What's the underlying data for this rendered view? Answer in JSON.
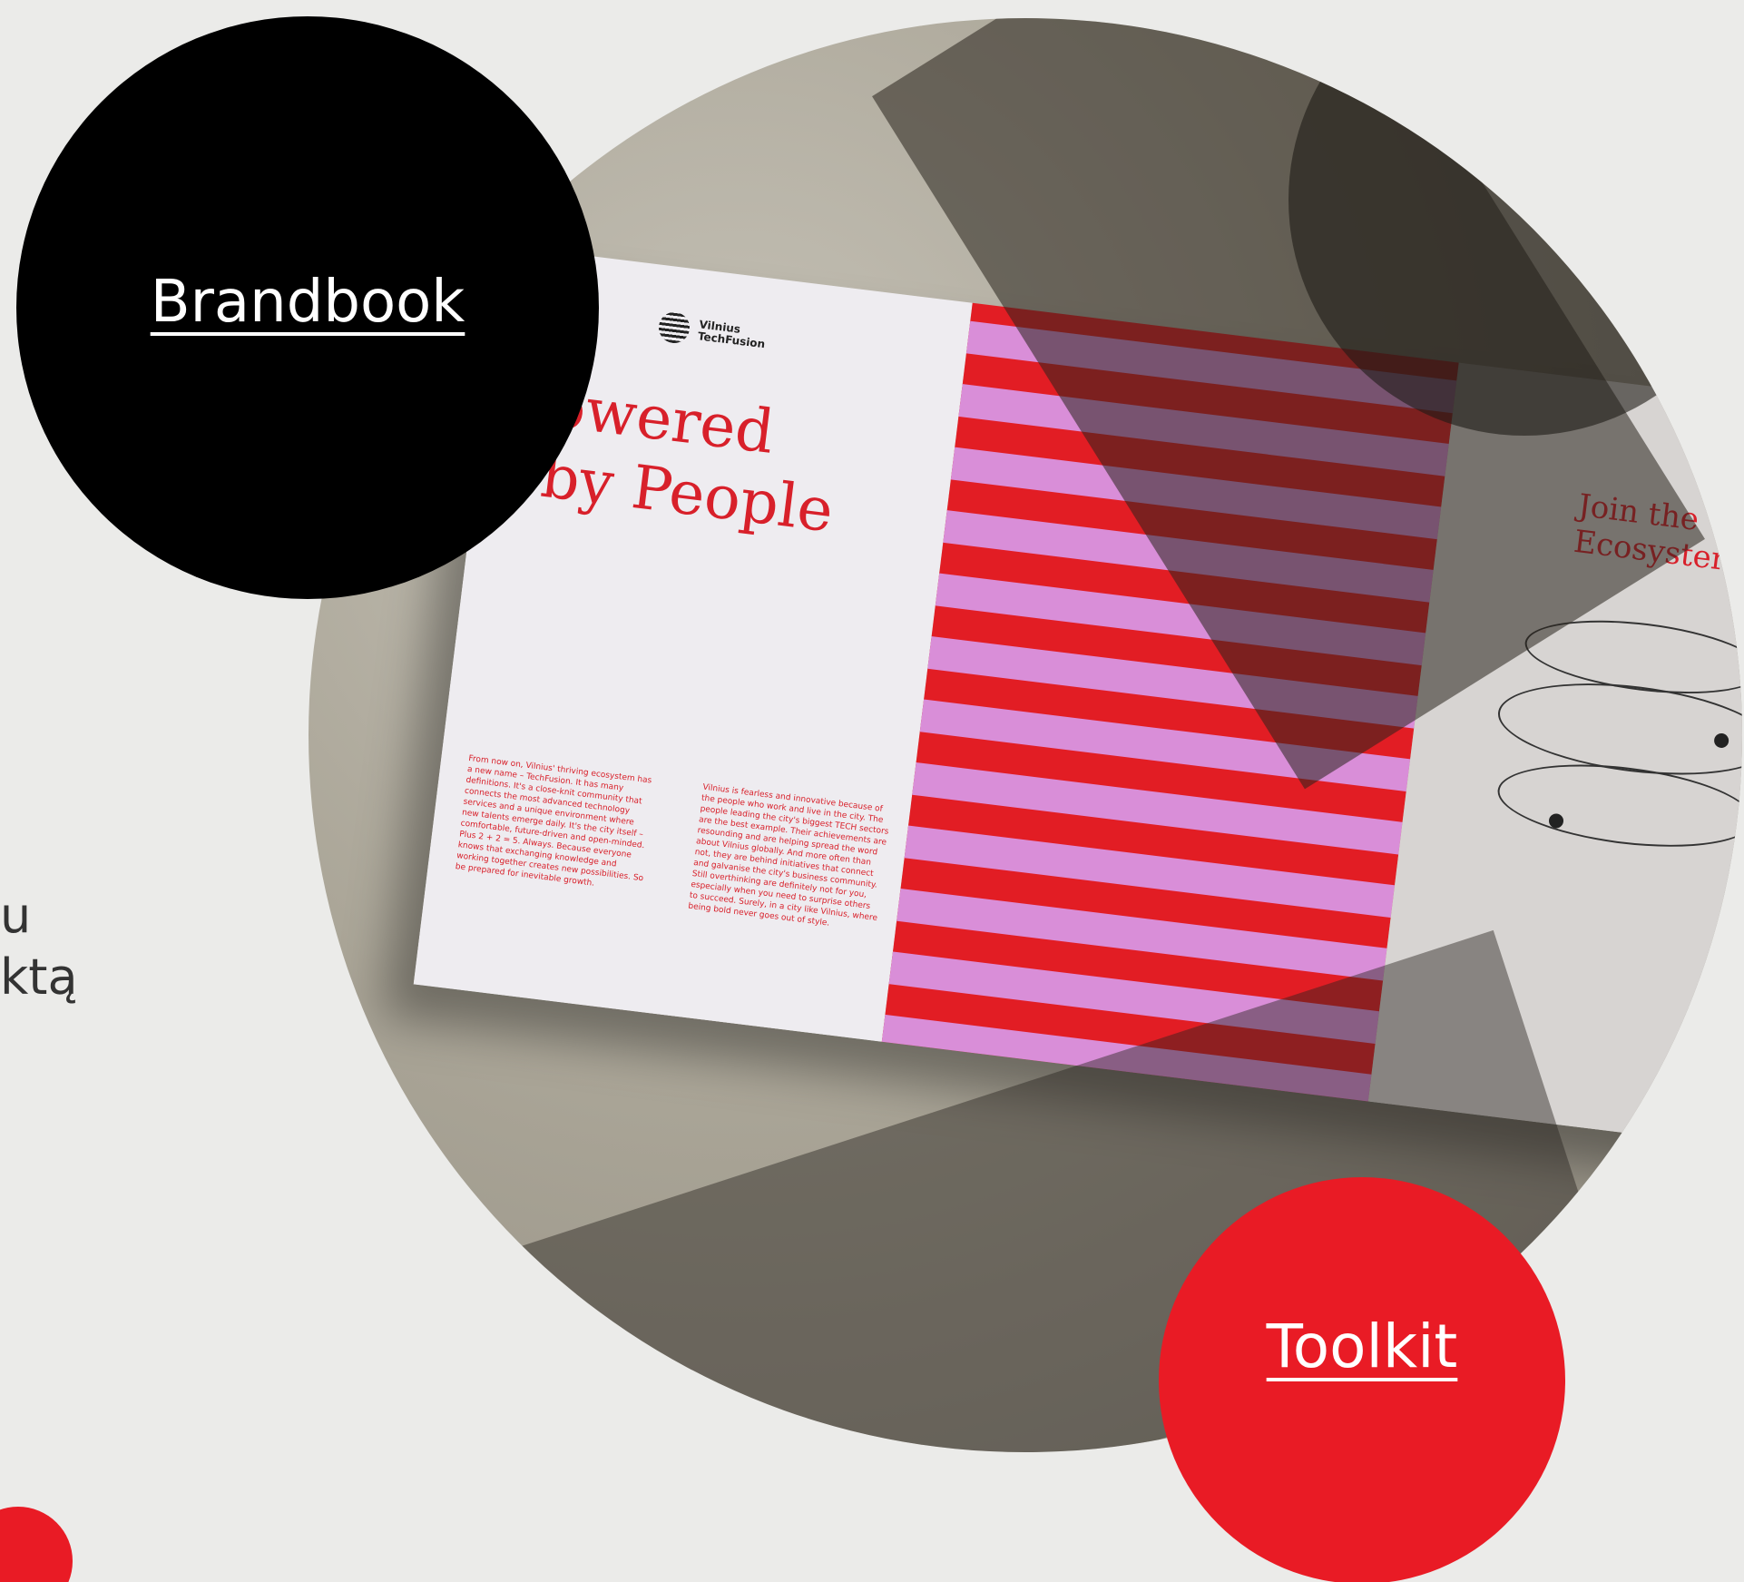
{
  "partial_text": {
    "line1": "u",
    "line2": "ktą"
  },
  "links": {
    "brandbook": "Brandbook",
    "toolkit": "Toolkit"
  },
  "brochure": {
    "logo_text": "Vilnius\nTechFusion",
    "headline": "Powered\n  by People",
    "right_title": "Join the\nEcosyster",
    "body_col1": "From now on, Vilnius' thriving ecosystem has a new name – TechFusion. It has many definitions. It's a close-knit community that connects the most advanced technology services and a unique environment where new talents emerge daily. It's the city itself – comfortable, future-driven and open-minded. Plus 2 + 2 = 5. Always. Because everyone knows that exchanging knowledge and working together creates new possibilities. So be prepared for inevitable growth.",
    "body_col2": "Vilnius is fearless and innovative because of the people who work and live in the city. The people leading the city's biggest TECH sectors are the best example. Their achievements are resounding and are helping spread the word about Vilnius globally. And more often than not, they are behind initiatives that connect and galvanise the city's business community. Still overthinking are definitely not for you, especially when you need to surprise others to succeed. Surely, in a city like Vilnius, where being bold never goes out of style."
  },
  "colors": {
    "background": "#ebebe9",
    "black": "#000000",
    "red": "#e91b25",
    "pink": "#d98ed8"
  }
}
